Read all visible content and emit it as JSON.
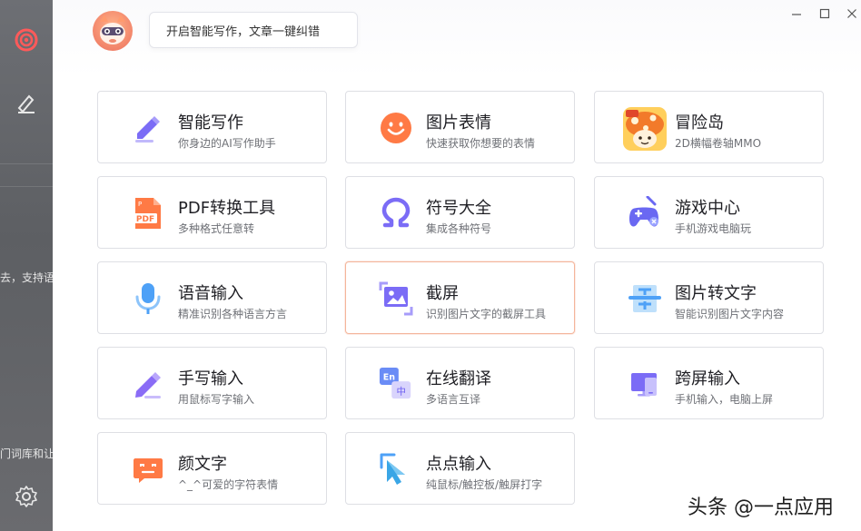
{
  "window": {
    "minimize_glyph": "—",
    "maximize_glyph": "□",
    "close_glyph": "✕"
  },
  "header": {
    "greeting": "开启智能写作，文章一键纠错"
  },
  "background_text": {
    "line1": "去，支持语",
    "line2": "门词库和让"
  },
  "tools": [
    {
      "title": "智能写作",
      "subtitle": "你身边的AI写作助手",
      "icon": "pen-write-icon"
    },
    {
      "title": "图片表情",
      "subtitle": "快速获取你想要的表情",
      "icon": "smiley-icon"
    },
    {
      "title": "冒险岛",
      "subtitle": "2D横幅卷轴MMO",
      "icon": "maplestory-mushroom-icon"
    },
    {
      "title": "PDF转换工具",
      "subtitle": "多种格式任意转",
      "icon": "pdf-file-icon",
      "badge": "PDF"
    },
    {
      "title": "符号大全",
      "subtitle": "集成各种符号",
      "icon": "omega-icon"
    },
    {
      "title": "游戏中心",
      "subtitle": "手机游戏电脑玩",
      "icon": "gamepad-icon"
    },
    {
      "title": "语音输入",
      "subtitle": "精准识别各种语言方言",
      "icon": "microphone-icon"
    },
    {
      "title": "截屏",
      "subtitle": "识别图片文字的截屏工具",
      "icon": "screenshot-crop-icon"
    },
    {
      "title": "图片转文字",
      "subtitle": "智能识别图片文字内容",
      "icon": "image-to-text-icon"
    },
    {
      "title": "手写输入",
      "subtitle": "用鼠标写字输入",
      "icon": "pencil-icon"
    },
    {
      "title": "在线翻译",
      "subtitle": "多语言互译",
      "icon": "translate-icon",
      "badge_en": "En",
      "badge_zh": "中"
    },
    {
      "title": "跨屏输入",
      "subtitle": "手机输入，电脑上屏",
      "icon": "cross-screen-icon"
    },
    {
      "title": "颜文字",
      "subtitle": "^_^可爱的字符表情",
      "icon": "kaomoji-icon"
    },
    {
      "title": "点点输入",
      "subtitle": "纯鼠标/触控板/触屏打字",
      "icon": "click-cursor-icon"
    }
  ],
  "watermark": "头条 @一点应用",
  "colors": {
    "accent_orange": "#ff7a45",
    "accent_purple": "#7b6cf6",
    "accent_blue": "#4ea1f7",
    "active_border": "#f4b59b"
  }
}
